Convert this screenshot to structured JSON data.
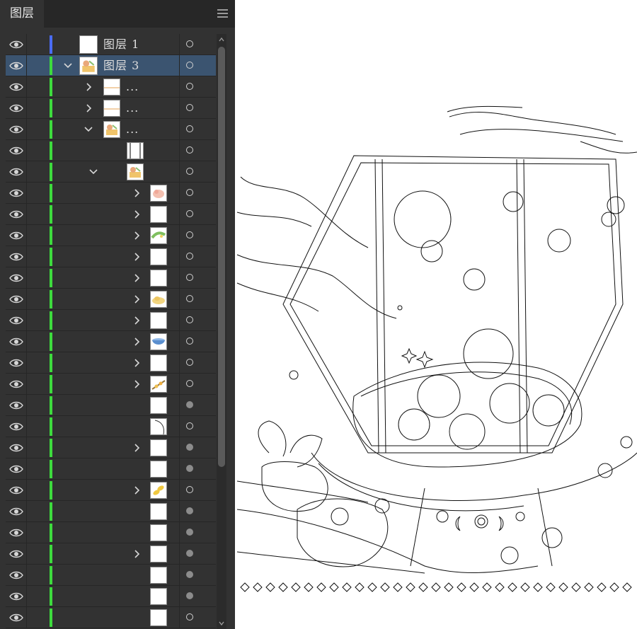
{
  "panel": {
    "tab_label": "图层",
    "menu_icon": "hamburger-menu-icon",
    "colors": {
      "blue_marker": "#4a6cf5",
      "green_marker": "#3ddb3d",
      "selection": "#3b5470"
    }
  },
  "layers": [
    {
      "id": "r0",
      "name": "图层  1",
      "depth": 0,
      "expand": "none",
      "thumb": "white",
      "color": "blue",
      "selected": false,
      "target": "hollow"
    },
    {
      "id": "r1",
      "name": "图层  3",
      "depth": 0,
      "expand": "open",
      "thumb": "art",
      "color": "green",
      "selected": true,
      "target": "hollow"
    },
    {
      "id": "r2",
      "name": "...",
      "depth": 1,
      "expand": "closed",
      "thumb": "line",
      "color": "green",
      "selected": false,
      "target": "hollow"
    },
    {
      "id": "r3",
      "name": "...",
      "depth": 1,
      "expand": "closed",
      "thumb": "line",
      "color": "green",
      "selected": false,
      "target": "hollow"
    },
    {
      "id": "r4",
      "name": "...",
      "depth": 1,
      "expand": "open",
      "thumb": "art",
      "color": "green",
      "selected": false,
      "target": "hollow"
    },
    {
      "id": "r5",
      "name": "",
      "depth": 2,
      "expand": "none",
      "thumb": "frame",
      "color": "green",
      "selected": false,
      "target": "hollow"
    },
    {
      "id": "r6",
      "name": "",
      "depth": 2,
      "expand": "open",
      "thumb": "art",
      "color": "green",
      "selected": false,
      "target": "hollow"
    },
    {
      "id": "r7",
      "name": "",
      "depth": 3,
      "expand": "closed",
      "thumb": "pink",
      "color": "green",
      "selected": false,
      "target": "hollow"
    },
    {
      "id": "r8",
      "name": "",
      "depth": 3,
      "expand": "closed",
      "thumb": "white",
      "color": "green",
      "selected": false,
      "target": "hollow"
    },
    {
      "id": "r9",
      "name": "",
      "depth": 3,
      "expand": "closed",
      "thumb": "greenart",
      "color": "green",
      "selected": false,
      "target": "hollow"
    },
    {
      "id": "r10",
      "name": "",
      "depth": 3,
      "expand": "closed",
      "thumb": "white",
      "color": "green",
      "selected": false,
      "target": "hollow"
    },
    {
      "id": "r11",
      "name": "",
      "depth": 3,
      "expand": "closed",
      "thumb": "white",
      "color": "green",
      "selected": false,
      "target": "hollow"
    },
    {
      "id": "r12",
      "name": "",
      "depth": 3,
      "expand": "closed",
      "thumb": "yellow",
      "color": "green",
      "selected": false,
      "target": "hollow"
    },
    {
      "id": "r13",
      "name": "",
      "depth": 3,
      "expand": "closed",
      "thumb": "white",
      "color": "green",
      "selected": false,
      "target": "hollow"
    },
    {
      "id": "r14",
      "name": "",
      "depth": 3,
      "expand": "closed",
      "thumb": "bowl",
      "color": "green",
      "selected": false,
      "target": "hollow"
    },
    {
      "id": "r15",
      "name": "",
      "depth": 3,
      "expand": "closed",
      "thumb": "white",
      "color": "green",
      "selected": false,
      "target": "hollow"
    },
    {
      "id": "r16",
      "name": "",
      "depth": 3,
      "expand": "closed",
      "thumb": "branch",
      "color": "green",
      "selected": false,
      "target": "hollow"
    },
    {
      "id": "r17",
      "name": "",
      "depth": 3,
      "expand": "none",
      "thumb": "white",
      "color": "green",
      "selected": false,
      "target": "filled"
    },
    {
      "id": "r18",
      "name": "",
      "depth": 3,
      "expand": "none",
      "thumb": "curve",
      "color": "green",
      "selected": false,
      "target": "hollow"
    },
    {
      "id": "r19",
      "name": "",
      "depth": 3,
      "expand": "closed",
      "thumb": "white",
      "color": "green",
      "selected": false,
      "target": "filled"
    },
    {
      "id": "r20",
      "name": "",
      "depth": 3,
      "expand": "none",
      "thumb": "white",
      "color": "green",
      "selected": false,
      "target": "filled"
    },
    {
      "id": "r21",
      "name": "",
      "depth": 3,
      "expand": "closed",
      "thumb": "yellowleaf",
      "color": "green",
      "selected": false,
      "target": "hollow"
    },
    {
      "id": "r22",
      "name": "",
      "depth": 3,
      "expand": "none",
      "thumb": "white",
      "color": "green",
      "selected": false,
      "target": "filled"
    },
    {
      "id": "r23",
      "name": "",
      "depth": 3,
      "expand": "none",
      "thumb": "white",
      "color": "green",
      "selected": false,
      "target": "filled"
    },
    {
      "id": "r24",
      "name": "",
      "depth": 3,
      "expand": "closed",
      "thumb": "white",
      "color": "green",
      "selected": false,
      "target": "filled"
    },
    {
      "id": "r25",
      "name": "",
      "depth": 3,
      "expand": "none",
      "thumb": "white",
      "color": "green",
      "selected": false,
      "target": "filled"
    },
    {
      "id": "r26",
      "name": "",
      "depth": 3,
      "expand": "none",
      "thumb": "white",
      "color": "green",
      "selected": false,
      "target": "filled"
    },
    {
      "id": "r27",
      "name": "",
      "depth": 3,
      "expand": "none",
      "thumb": "white",
      "color": "green",
      "selected": false,
      "target": "hollow"
    }
  ],
  "icons": {
    "visibility": "eye-icon",
    "expand_closed": "chevron-right-icon",
    "expand_open": "chevron-down-icon",
    "target": "target-circle-icon",
    "scroll_up": "scroll-up-arrow-icon",
    "scroll_down": "scroll-down-arrow-icon"
  }
}
